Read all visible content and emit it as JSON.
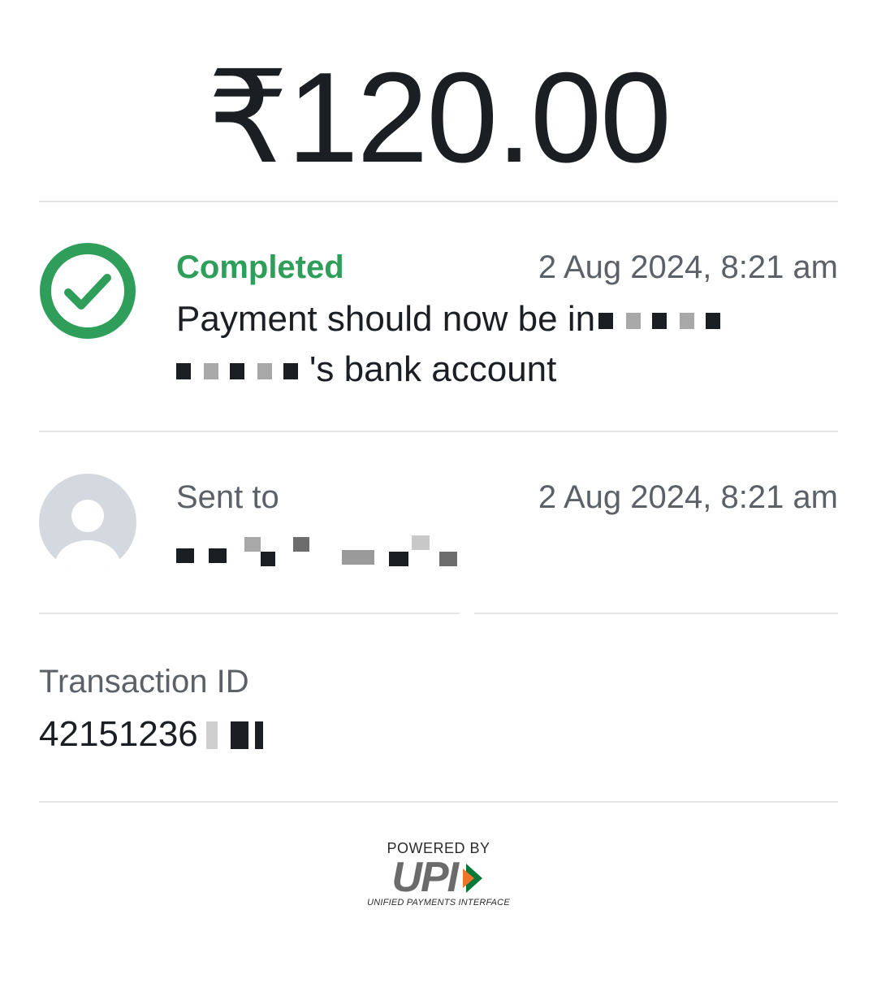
{
  "payment": {
    "amount": "₹120.00"
  },
  "status": {
    "label": "Completed",
    "timestamp": "2 Aug 2024, 8:21 am",
    "message_prefix": "Payment should now be in",
    "message_suffix": "'s bank account",
    "icon": "check-circle-icon",
    "color": "#2f9e5a"
  },
  "recipient": {
    "label": "Sent to",
    "timestamp": "2 Aug 2024, 8:21 am",
    "avatar_icon": "user-avatar-icon"
  },
  "transaction": {
    "label": "Transaction ID",
    "id_visible": "42151236"
  },
  "footer": {
    "powered_by": "POWERED BY",
    "logo": "UPI",
    "tagline": "UNIFIED PAYMENTS INTERFACE"
  }
}
